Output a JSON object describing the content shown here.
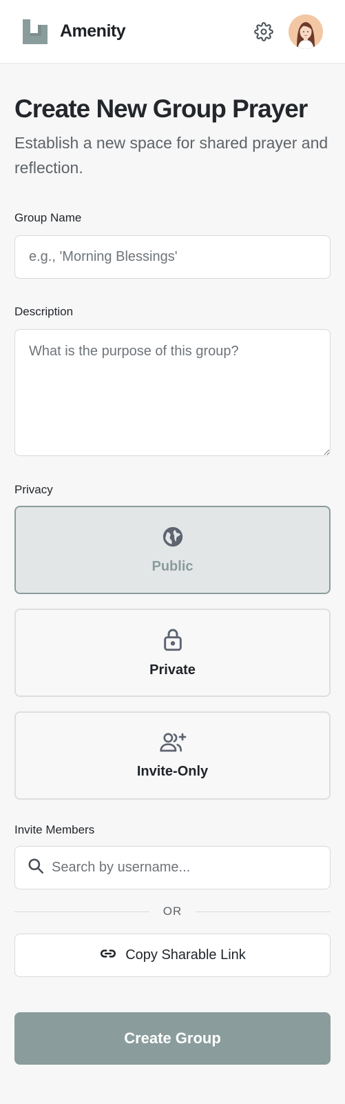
{
  "header": {
    "brand": "Amenity",
    "settings_icon": "gear-icon",
    "avatar_icon": "user-avatar"
  },
  "page": {
    "title": "Create New Group Prayer",
    "subtitle": "Establish a new space for shared prayer and reflection."
  },
  "form": {
    "group_name": {
      "label": "Group Name",
      "placeholder": "e.g., 'Morning Blessings'",
      "value": ""
    },
    "description": {
      "label": "Description",
      "placeholder": "What is the purpose of this group?",
      "value": ""
    },
    "privacy": {
      "label": "Privacy",
      "selected": "Public",
      "options": [
        {
          "label": "Public",
          "icon": "globe-icon"
        },
        {
          "label": "Private",
          "icon": "lock-icon"
        },
        {
          "label": "Invite-Only",
          "icon": "user-plus-icon"
        }
      ]
    },
    "invite": {
      "label": "Invite Members",
      "search_placeholder": "Search by username...",
      "divider": "OR",
      "copy_link_label": "Copy Sharable Link"
    },
    "submit_label": "Create Group"
  },
  "colors": {
    "accent": "#8a9c9c",
    "selected_bg": "#e3e6e7",
    "background": "#f7f7f7"
  }
}
